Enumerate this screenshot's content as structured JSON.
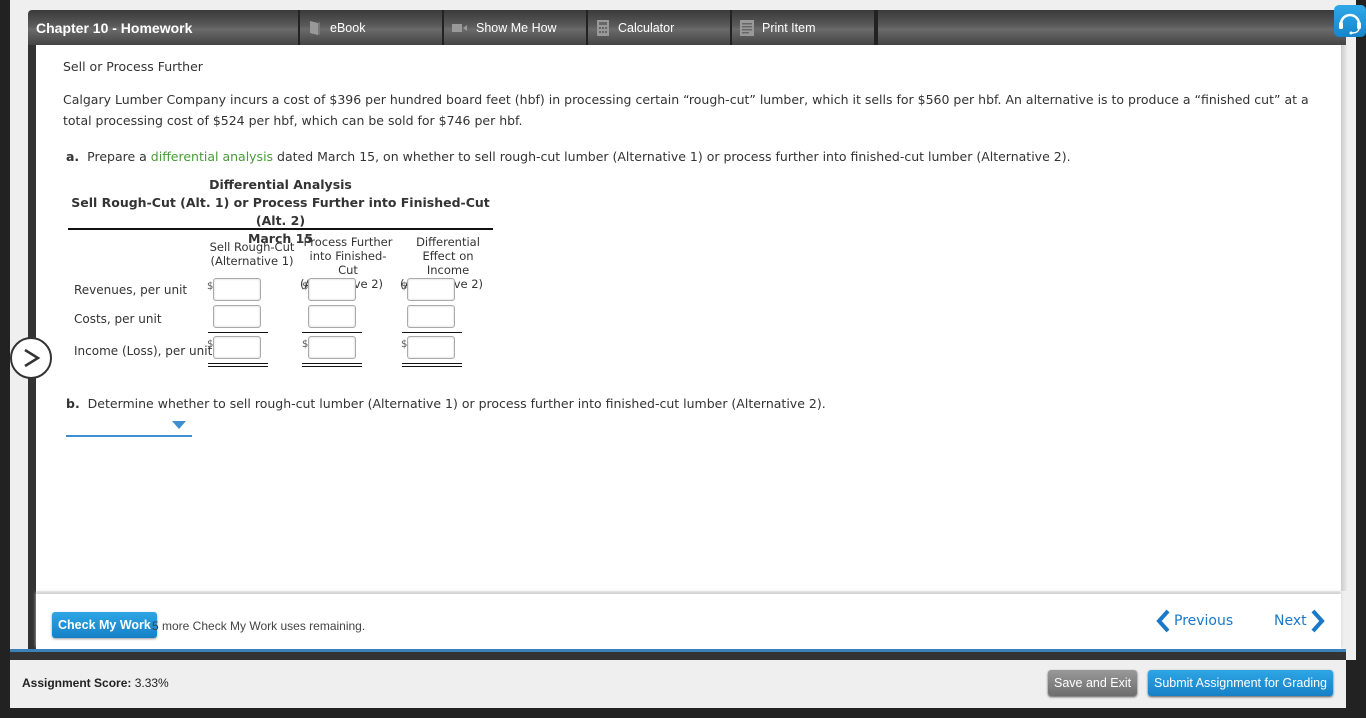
{
  "header": {
    "title": "Chapter 10 - Homework",
    "tabs": [
      {
        "label": "eBook",
        "icon": "book-icon"
      },
      {
        "label": "Show Me How",
        "icon": "video-icon"
      },
      {
        "label": "Calculator",
        "icon": "calculator-icon"
      },
      {
        "label": "Print Item",
        "icon": "print-icon"
      }
    ],
    "support_icon": "headset-icon"
  },
  "question": {
    "title": "Sell or Process Further",
    "body": "Calgary Lumber Company incurs a cost of $396 per hundred board feet (hbf) in processing certain “rough-cut” lumber, which it sells for $560 per hbf. An alternative is to produce a “finished cut” at a total processing cost of $524 per hbf, which can be sold for $746 per hbf.",
    "part_a": {
      "label": "a.",
      "pre": "Prepare a ",
      "link": "differential analysis",
      "post": " dated March 15, on whether to sell rough-cut lumber (Alternative 1) or process further into finished-cut lumber (Alternative 2)."
    },
    "analysis": {
      "title": "Differential Analysis",
      "subtitle": "Sell Rough-Cut (Alt. 1) or Process Further into Finished-Cut (Alt. 2)",
      "date": "March 15",
      "columns": [
        {
          "line1": "Sell Rough-Cut",
          "line2": "(Alternative 1)",
          "line3": ""
        },
        {
          "line1": "Process Further",
          "line2": "into Finished-Cut",
          "line3": "(Alternative 2)"
        },
        {
          "line1": "Differential",
          "line2": "Effect on Income",
          "line3": "(Alternative 2)"
        }
      ],
      "rows": [
        {
          "label": "Revenues, per unit",
          "values": [
            "",
            "",
            ""
          ],
          "currency": "$"
        },
        {
          "label": "Costs, per unit",
          "values": [
            "",
            "",
            ""
          ],
          "currency": ""
        },
        {
          "label": "Income (Loss), per unit",
          "values": [
            "",
            "",
            ""
          ],
          "currency": "$"
        }
      ]
    },
    "part_b": {
      "label": "b.",
      "text": "Determine whether to sell rough-cut lumber (Alternative 1) or process further into finished-cut lumber (Alternative 2).",
      "selected": ""
    }
  },
  "bottom": {
    "check_label": "Check My Work",
    "remaining": "5 more Check My Work uses remaining.",
    "previous": "Previous",
    "next": "Next"
  },
  "footer": {
    "score_label": "Assignment Score:",
    "score_value": "3.33%",
    "save_label": "Save and Exit",
    "submit_label": "Submit Assignment for Grading"
  },
  "colors": {
    "accent": "#1a78c8",
    "button_blue": "#1e93d6",
    "link_green": "#4a9a3a",
    "toolbar": "#4f4f4f"
  }
}
